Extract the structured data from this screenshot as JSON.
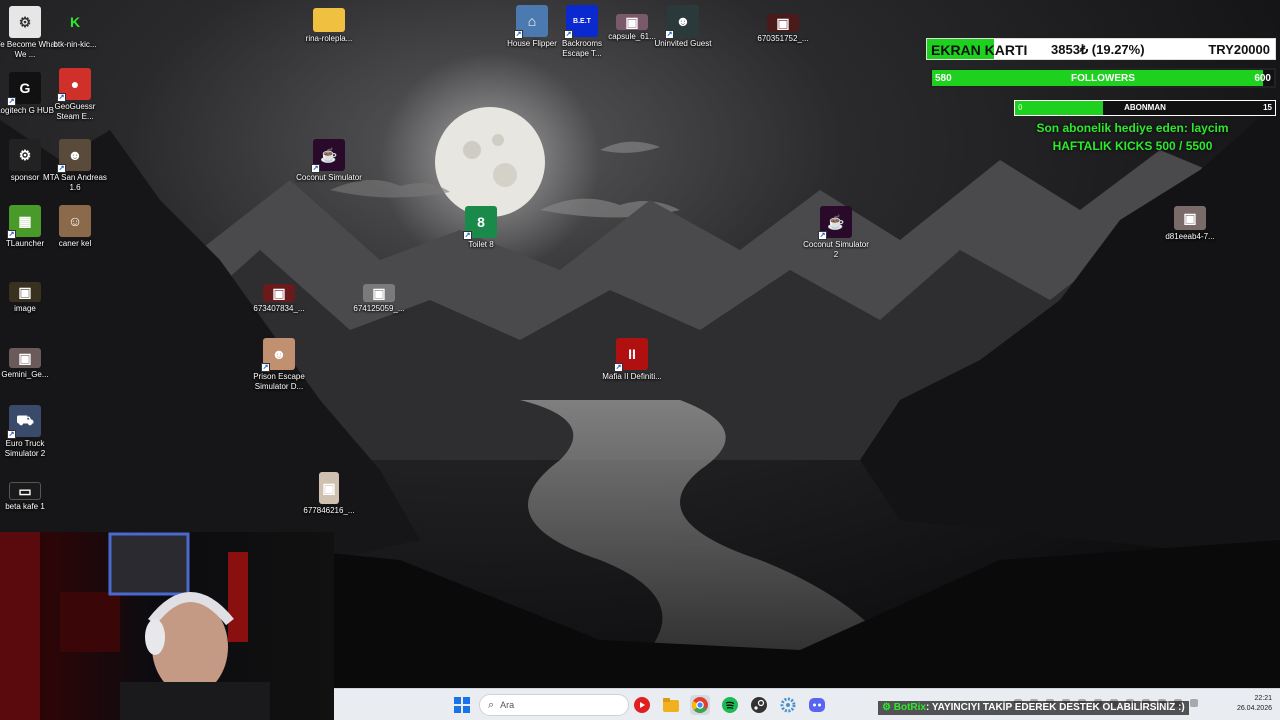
{
  "desktop_icons": [
    {
      "label": "We Become What We ...",
      "color": "#e6e6e6",
      "glyph": "⚙",
      "shortcut": false
    },
    {
      "label": "btk-nin-kic...",
      "color": "#000000",
      "glyph": "K",
      "shortcut": false
    },
    {
      "label": "Logitech G HUB",
      "color": "#111111",
      "glyph": "G",
      "shortcut": true
    },
    {
      "label": "GeoGuessr Steam E...",
      "color": "#d0302a",
      "glyph": "📍",
      "shortcut": true
    },
    {
      "label": "sponsor",
      "color": "#222222",
      "glyph": "⚙",
      "shortcut": false
    },
    {
      "label": "MTA San Andreas 1.6",
      "color": "#5a4a3a",
      "glyph": "☻",
      "shortcut": true
    },
    {
      "label": "TLauncher",
      "color": "#4a9a2a",
      "glyph": "▦",
      "shortcut": true
    },
    {
      "label": "caner kel",
      "color": "#8a6a4a",
      "glyph": "☺",
      "shortcut": false
    },
    {
      "label": "image",
      "color": "#3a3020",
      "glyph": "▣",
      "shortcut": false
    },
    {
      "label": "Gemini_Ge...",
      "color": "#6a5a5a",
      "glyph": "▣",
      "shortcut": false
    },
    {
      "label": "Euro Truck Simulator 2",
      "color": "#3a4a6a",
      "glyph": "⛟",
      "shortcut": true
    },
    {
      "label": "beta kafe 1",
      "color": "#1a1a1a",
      "glyph": "▭",
      "shortcut": false
    },
    {
      "label": "rina-rolepla...",
      "color": "#f0c040",
      "glyph": "▬",
      "shortcut": false
    },
    {
      "label": "Coconut Simulator",
      "color": "#2a0a2a",
      "glyph": "🥥",
      "shortcut": true
    },
    {
      "label": "673407834_...",
      "color": "#6a1a1a",
      "glyph": "▣",
      "shortcut": false
    },
    {
      "label": "674125059_...",
      "color": "#7a7a7a",
      "glyph": "▣",
      "shortcut": false
    },
    {
      "label": "Prison Escape Simulator D...",
      "color": "#c09070",
      "glyph": "☻",
      "shortcut": true
    },
    {
      "label": "677846216_...",
      "color": "#d0c0b0",
      "glyph": "▣",
      "shortcut": false
    },
    {
      "label": "Toilet 8",
      "color": "#1a8a4a",
      "glyph": "8",
      "shortcut": true
    },
    {
      "label": "House Flipper",
      "color": "#4a7ab0",
      "glyph": "⌂",
      "shortcut": true
    },
    {
      "label": "Backrooms Escape T...",
      "color": "#0a2ad0",
      "glyph": "B.E.T",
      "shortcut": true
    },
    {
      "label": "capsule_61...",
      "color": "#7a5a6a",
      "glyph": "▣",
      "shortcut": false
    },
    {
      "label": "Uninvited Guest",
      "color": "#2a3a3a",
      "glyph": "☻",
      "shortcut": true
    },
    {
      "label": "Mafia II Definiti...",
      "color": "#b01010",
      "glyph": "II",
      "shortcut": true
    },
    {
      "label": "670351752_...",
      "color": "#4a1a1a",
      "glyph": "▣",
      "shortcut": false
    },
    {
      "label": "Coconut Simulator 2",
      "color": "#2a0a2a",
      "glyph": "🥥",
      "shortcut": true
    },
    {
      "label": "d81eeab4-7...",
      "color": "#7a6a6a",
      "glyph": "▣",
      "shortcut": false
    }
  ],
  "overlay": {
    "ekran_label": "EKRAN KARTI",
    "ekran_amount": "3853₺ (19.27%)",
    "ekran_goal": "TRY20000",
    "ekran_progress": 0.1927,
    "followers_current": "580",
    "followers_label": "FOLLOWERS",
    "followers_goal": "600",
    "followers_progress": 0.9667,
    "abonman_current": "0",
    "abonman_label": "ABONMAN",
    "abonman_goal": "15",
    "abonman_progress": 0.34,
    "gift_text": "Son abonelik hediye eden: laycim",
    "kicks_text": "HAFTALIK KICKS 500 / 5500"
  },
  "taskbar": {
    "search_placeholder": "Ara",
    "chat_user": "BotRix",
    "chat_message": ": YAYINCIYI TAKİP EDEREK DESTEK OLABİLİRSİNİZ :)",
    "time": "22:21",
    "date": "26.04.2026",
    "pinned": [
      {
        "name": "windows-start-icon",
        "color": "#1a73e8"
      },
      {
        "name": "search-icon",
        "color": "#333333"
      },
      {
        "name": "youtube-music-icon",
        "color": "#e02020"
      },
      {
        "name": "file-explorer-icon",
        "color": "#f0b020"
      },
      {
        "name": "chrome-icon",
        "color": "#e04030"
      },
      {
        "name": "spotify-icon",
        "color": "#1db954"
      },
      {
        "name": "steam-icon",
        "color": "#333333"
      },
      {
        "name": "settings-icon",
        "color": "#4a90d0"
      },
      {
        "name": "discord-icon",
        "color": "#5865f2"
      }
    ]
  }
}
